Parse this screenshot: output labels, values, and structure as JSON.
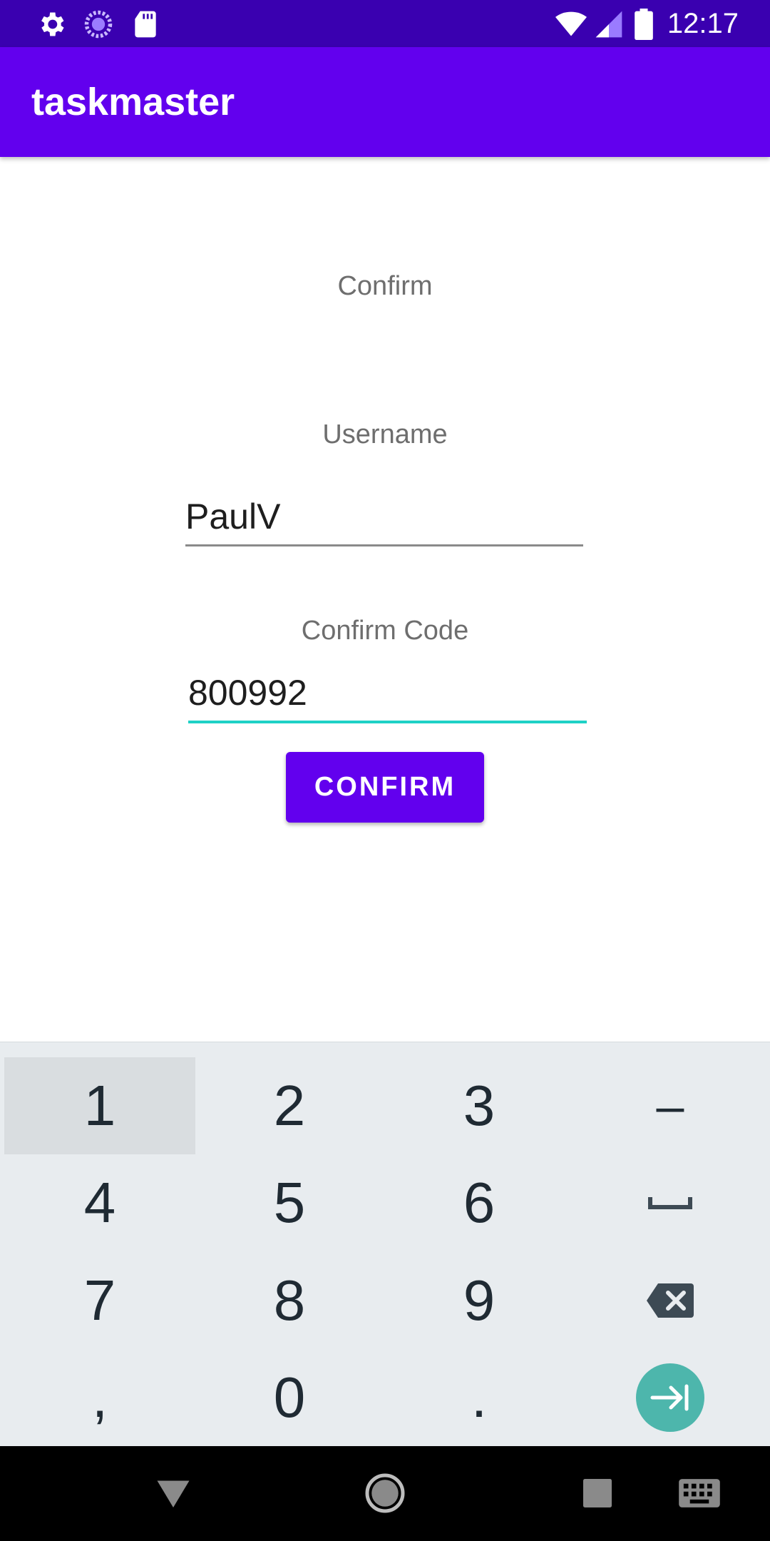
{
  "status_bar": {
    "time": "12:17",
    "left_icons": [
      "settings-icon",
      "loading-icon",
      "sd-card-icon"
    ],
    "right_icons": [
      "wifi-icon",
      "cellular-signal-icon",
      "battery-icon"
    ]
  },
  "app_bar": {
    "title": "taskmaster"
  },
  "form": {
    "heading": "Confirm",
    "username_label": "Username",
    "username_value": "PaulV",
    "code_label": "Confirm Code",
    "code_value": "800992",
    "confirm_button": "CONFIRM"
  },
  "keyboard": {
    "rows": [
      [
        "1",
        "2",
        "3",
        "–"
      ],
      [
        "4",
        "5",
        "6",
        "space-icon"
      ],
      [
        "7",
        "8",
        "9",
        "backspace-icon"
      ],
      [
        ",",
        "0",
        ".",
        "next-field-icon"
      ]
    ],
    "pressed_key": "1"
  },
  "nav_bar": {
    "buttons": [
      "back-icon",
      "home-icon",
      "recents-icon",
      "keyboard-switch-icon"
    ]
  },
  "colors": {
    "status_bar": "#3a00b0",
    "primary": "#6200ee",
    "accent": "#1fd1c6",
    "keyboard_bg": "#e8ecef",
    "enter_key": "#4db6ac"
  }
}
